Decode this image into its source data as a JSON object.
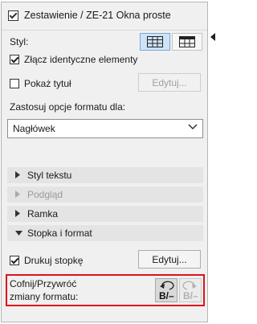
{
  "titlebar": {
    "title": "Zestawienie / ZE-21 Okna proste"
  },
  "style_section": {
    "label": "Styl:",
    "options": [
      "grid-layout-icon-a",
      "grid-layout-icon-b"
    ],
    "active_index": 0
  },
  "merge_checkbox": {
    "label": "Złącz identyczne elementy",
    "checked": true
  },
  "show_title": {
    "label": "Pokaż tytuł",
    "checked": false,
    "button_label": "Edytuj..."
  },
  "format_options": {
    "label": "Zastosuj opcje formatu dla:",
    "selected": "Nagłówek"
  },
  "sections": [
    {
      "label": "Styl tekstu",
      "expanded": false,
      "enabled": true
    },
    {
      "label": "Podgląd",
      "expanded": false,
      "enabled": false
    },
    {
      "label": "Ramka",
      "expanded": false,
      "enabled": true
    },
    {
      "label": "Stopka i format",
      "expanded": true,
      "enabled": true
    }
  ],
  "print_footer": {
    "label": "Drukuj stopkę",
    "checked": true,
    "button_label": "Edytuj..."
  },
  "undo_redo": {
    "label_line1": "Cofnij/Przywróć",
    "label_line2": "zmiany formatu:",
    "undo_glyph": "B/–",
    "redo_glyph": "B/–"
  },
  "colors": {
    "highlight_border": "#e0101c",
    "active_toggle": "#cfe3f7",
    "section_header": "#e4e4e4"
  }
}
